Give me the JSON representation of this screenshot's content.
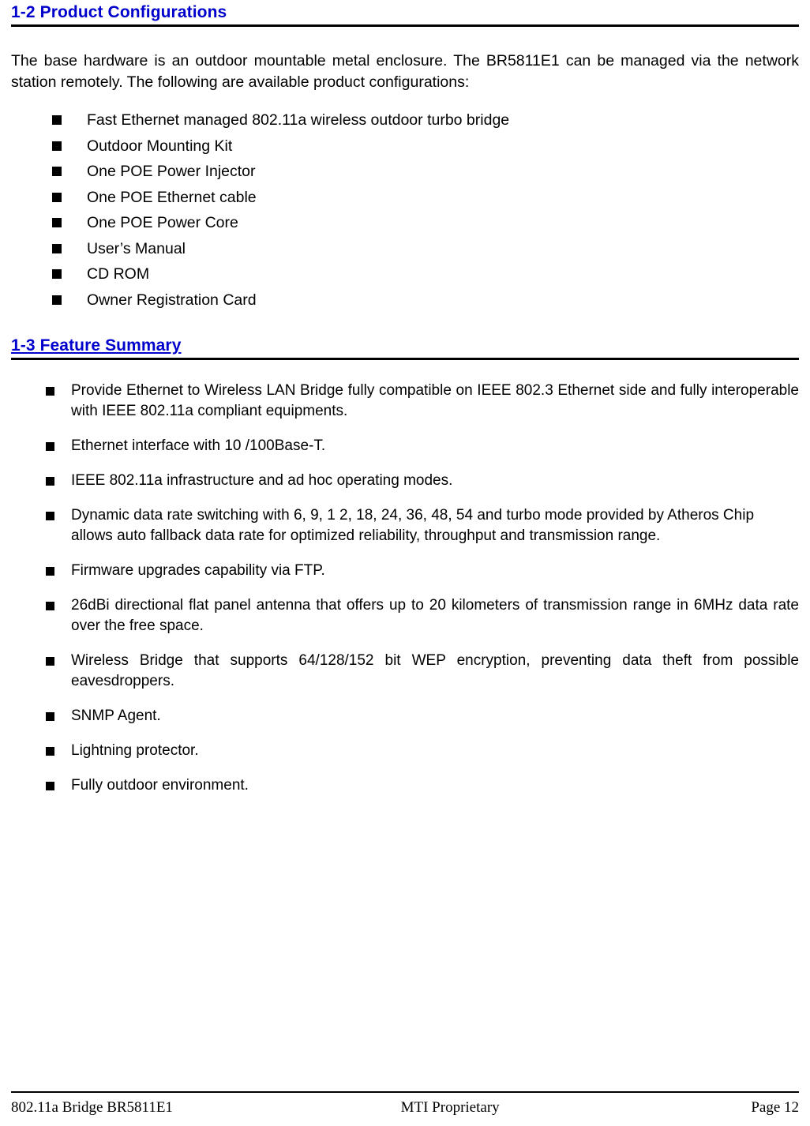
{
  "document": {
    "sections": [
      {
        "number": "1-2",
        "title": "1-2 Product Configurations",
        "underlined": false
      },
      {
        "number": "1-3",
        "title": "1-3 Feature Summary",
        "underlined": true
      }
    ],
    "intro_paragraph": "The base hardware is an outdoor mountable metal enclosure. The BR5811E1 can be managed via the network station remotely. The following are available product configurations:",
    "configurations": [
      "Fast Ethernet managed 802.11a wireless outdoor turbo bridge",
      "Outdoor Mounting Kit",
      "One POE Power Injector",
      "One POE Ethernet cable",
      "One POE Power Core",
      "User’s Manual",
      "CD ROM",
      "Owner Registration Card"
    ],
    "features": [
      "Provide Ethernet to Wireless LAN Bridge fully compatible on IEEE 802.3 Ethernet side and fully interoperable with IEEE 802.11a compliant equipments.",
      "Ethernet interface with 10 /100Base-T.",
      "IEEE 802.11a infrastructure and ad hoc operating modes.",
      "Dynamic data rate switching with 6, 9, 1 2, 18, 24, 36, 48, 54 and turbo mode provided by Atheros Chip allows auto fallback data rate for optimized reliability, throughput and transmission range.",
      "Firmware upgrades capability via FTP.",
      "26dBi directional flat panel antenna that offers up to 20 kilometers of transmission range in 6MHz data rate over the free space.",
      "Wireless Bridge that supports 64/128/152 bit WEP encryption, preventing data theft from possible eavesdroppers.",
      "SNMP Agent.",
      "Lightning protector.",
      "Fully outdoor environment."
    ],
    "footer": {
      "left": "802.11a Bridge BR5811E1",
      "center": "MTI Proprietary",
      "right": "Page 12"
    },
    "colors": {
      "heading": "#0000cd",
      "text": "#000000",
      "background": "#ffffff"
    }
  }
}
